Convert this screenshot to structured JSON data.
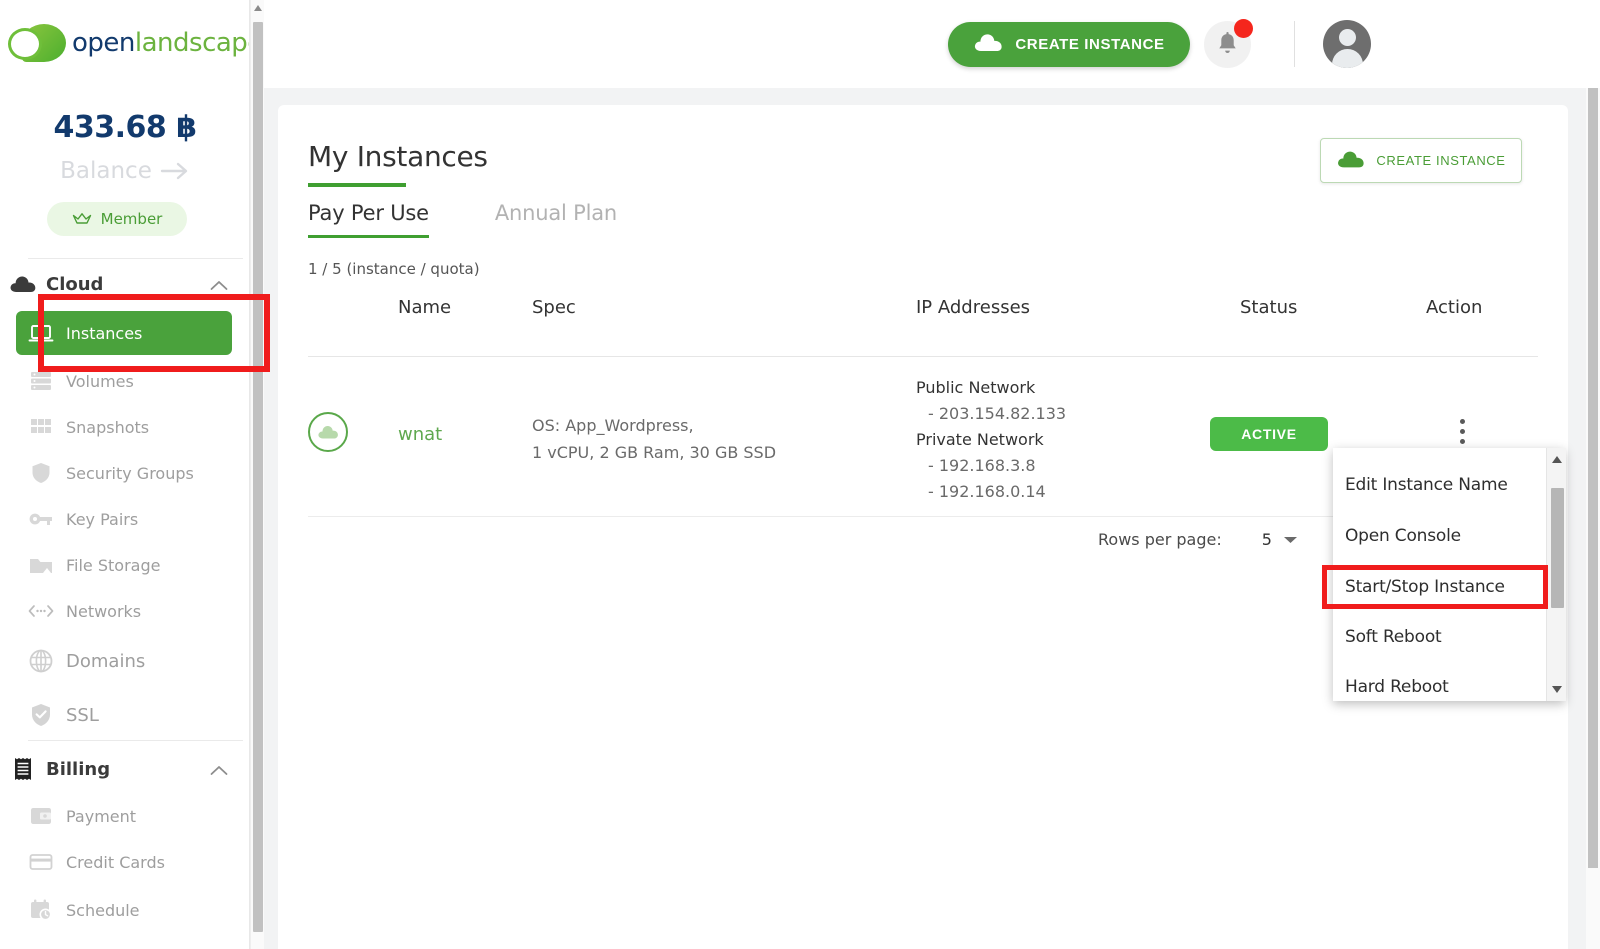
{
  "brand": {
    "logo_open": "open",
    "logo_landscape": "landscape",
    "accent_green": "#4aa23c",
    "accent_navy": "#123a6d",
    "status_green": "#4cbb48",
    "highlight_red": "#f01c1c"
  },
  "sidebar": {
    "balance_amount": "433.68 ฿",
    "balance_label": "Balance",
    "member_badge": "Member",
    "groups": [
      {
        "label": "Cloud",
        "icon": "cloud-icon",
        "chevron": "chevron-up-icon"
      },
      {
        "label": "Billing",
        "icon": "receipt-icon",
        "chevron": "chevron-up-icon"
      }
    ],
    "cloud_items": [
      {
        "label": "Instances",
        "icon": "laptop-icon",
        "active": true
      },
      {
        "label": "Volumes",
        "icon": "volumes-icon",
        "active": false
      },
      {
        "label": "Snapshots",
        "icon": "snapshots-icon",
        "active": false
      },
      {
        "label": "Security Groups",
        "icon": "shield-icon",
        "active": false
      },
      {
        "label": "Key Pairs",
        "icon": "key-icon",
        "active": false
      },
      {
        "label": "File Storage",
        "icon": "folder-icon",
        "active": false
      },
      {
        "label": "Networks",
        "icon": "networks-icon",
        "active": false
      }
    ],
    "standalone_items": [
      {
        "label": "Domains",
        "icon": "globe-icon"
      },
      {
        "label": "SSL",
        "icon": "shield-check-icon"
      }
    ],
    "billing_items": [
      {
        "label": "Payment",
        "icon": "wallet-icon"
      },
      {
        "label": "Credit Cards",
        "icon": "credit-card-icon"
      },
      {
        "label": "Schedule",
        "icon": "calendar-clock-icon"
      }
    ]
  },
  "header": {
    "create_instance_label": "CREATE INSTANCE",
    "bell_icon": "bell-icon",
    "notification_badge": "",
    "avatar_icon": "avatar-icon"
  },
  "main": {
    "page_title": "My Instances",
    "create_instance_label": "CREATE INSTANCE",
    "tabs": [
      {
        "label": "Pay Per Use",
        "active": true
      },
      {
        "label": "Annual Plan",
        "active": false
      }
    ],
    "quota_text": "1 / 5 (instance / quota)",
    "table": {
      "columns": [
        "Name",
        "Spec",
        "IP Addresses",
        "Status",
        "Action"
      ],
      "rows": [
        {
          "name": "wnat",
          "icon": "cloud-instance-icon",
          "spec_line1": "OS: App_Wordpress,",
          "spec_line2": "1 vCPU, 2 GB Ram, 30 GB SSD",
          "public_label": "Public Network",
          "public_ip": "- 203.154.82.133",
          "private_label": "Private Network",
          "private_ip1": "- 192.168.3.8",
          "private_ip2": "- 192.168.0.14",
          "status": "ACTIVE",
          "action_icon": "kebab-menu-icon"
        }
      ]
    },
    "rows_per_page_label": "Rows per page:",
    "rows_per_page_value": "5"
  },
  "action_menu": {
    "items": [
      {
        "label": "Edit Instance Name",
        "highlighted": false
      },
      {
        "label": "Open Console",
        "highlighted": false
      },
      {
        "label": "Start/Stop Instance",
        "highlighted": true
      },
      {
        "label": "Soft Reboot",
        "highlighted": false
      },
      {
        "label": "Hard Reboot",
        "highlighted": false
      }
    ]
  }
}
